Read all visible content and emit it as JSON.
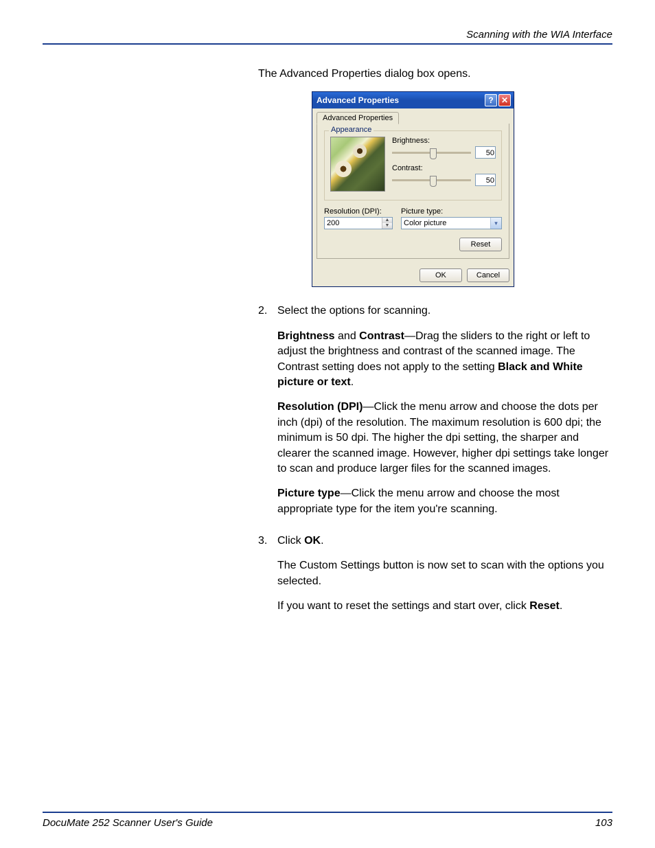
{
  "header": {
    "section_title": "Scanning with the WIA Interface"
  },
  "intro_text": "The Advanced Properties dialog box opens.",
  "dialog": {
    "title": "Advanced Properties",
    "tab_label": "Advanced Properties",
    "fieldset_legend": "Appearance",
    "brightness_label": "Brightness:",
    "brightness_value": "50",
    "contrast_label": "Contrast:",
    "contrast_value": "50",
    "resolution_label": "Resolution (DPI):",
    "resolution_value": "200",
    "picture_type_label": "Picture type:",
    "picture_type_value": "Color picture",
    "reset_btn": "Reset",
    "ok_btn": "OK",
    "cancel_btn": "Cancel"
  },
  "steps": {
    "step2": {
      "num": "2.",
      "lead": "Select the options for scanning.",
      "p1_strong1": "Brightness",
      "p1_mid1": " and ",
      "p1_strong2": "Contrast",
      "p1_rest1": "—Drag the sliders to the right or left to adjust the brightness and contrast of the scanned image. The Contrast setting does not apply to the setting ",
      "p1_strong3": "Black and White picture or text",
      "p1_end": ".",
      "p2_strong": "Resolution (DPI)",
      "p2_rest": "—Click the menu arrow and choose the dots per inch (dpi) of the resolution. The maximum resolution is 600 dpi; the minimum is 50 dpi. The higher the dpi setting, the sharper and clearer the scanned image. However, higher dpi settings take longer to scan and produce larger files for the scanned images.",
      "p3_strong": "Picture type",
      "p3_rest": "—Click the menu arrow and choose the most appropriate type for the item you're scanning."
    },
    "step3": {
      "num": "3.",
      "lead_pre": "Click ",
      "lead_strong": "OK",
      "lead_post": ".",
      "p1": "The Custom Settings button is now set to scan with the options you selected.",
      "p2_pre": "If you want to reset the settings and start over, click ",
      "p2_strong": "Reset",
      "p2_post": "."
    }
  },
  "footer": {
    "guide_name": "DocuMate 252 Scanner User's Guide",
    "page_num": "103"
  }
}
